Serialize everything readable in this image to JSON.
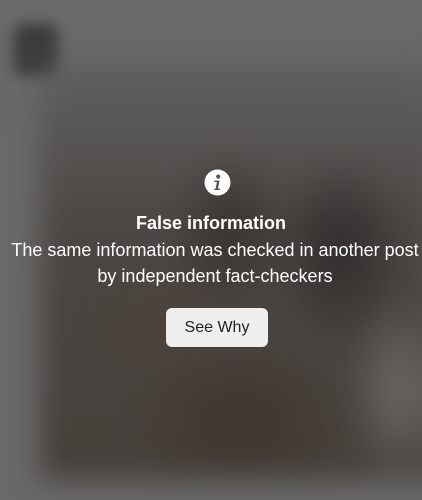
{
  "warning": {
    "icon": "info-icon",
    "title": "False information",
    "message": "The same information was checked in another post by independent fact-checkers",
    "button_label": "See Why"
  },
  "colors": {
    "text": "#ffffff",
    "button_bg": "#eeeeee",
    "button_text": "#222222"
  }
}
